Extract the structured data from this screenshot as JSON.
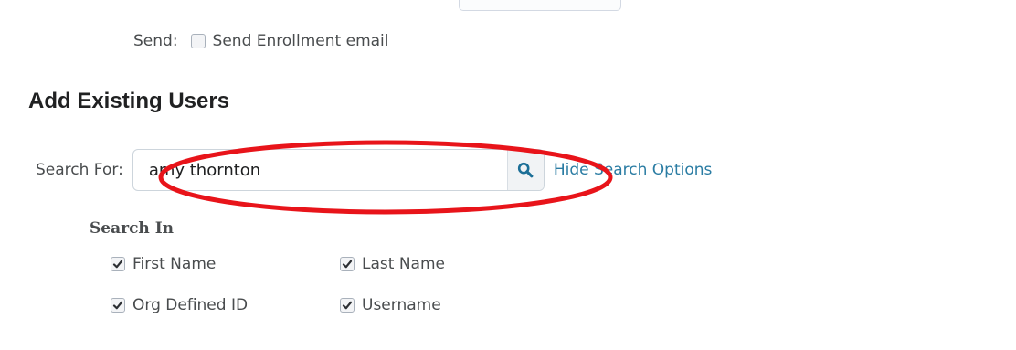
{
  "enrollment": {
    "send_label": "Send:",
    "send_email_label": "Send Enrollment email",
    "send_email_checked": false
  },
  "add_existing": {
    "title": "Add Existing Users",
    "search_label": "Search For:",
    "search_value": "amy thornton",
    "search_button_icon": "search-icon",
    "hide_options_label": "Hide Search Options",
    "annotation_color": "#e8141a"
  },
  "search_in": {
    "title": "Search In",
    "options": [
      {
        "label": "First Name",
        "checked": true
      },
      {
        "label": "Last Name",
        "checked": true
      },
      {
        "label": "Org Defined ID",
        "checked": true
      },
      {
        "label": "Username",
        "checked": true
      }
    ]
  },
  "colors": {
    "link": "#2a7ca3",
    "search_icon": "#1c6f97",
    "text": "#494c4e",
    "heading": "#202122"
  }
}
